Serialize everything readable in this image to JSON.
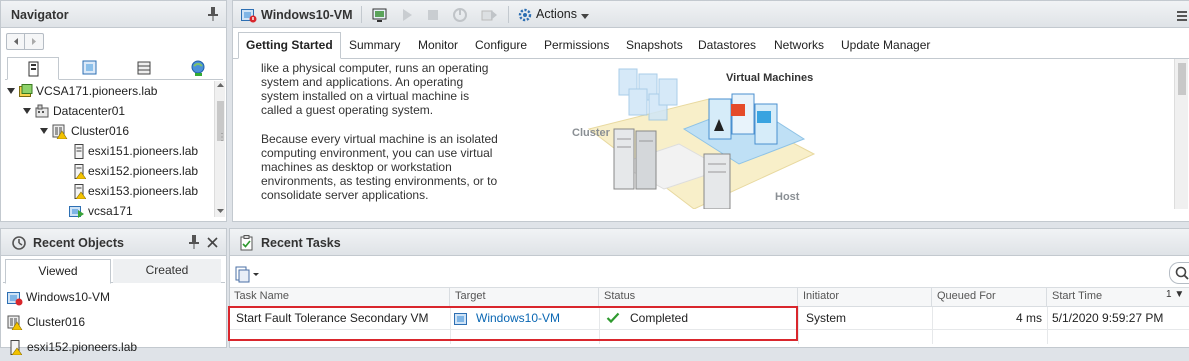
{
  "navigator": {
    "title": "Navigator",
    "tree": [
      {
        "label": "VCSA171.pioneers.lab"
      },
      {
        "label": "Datacenter01"
      },
      {
        "label": "Cluster016"
      },
      {
        "label": "esxi151.pioneers.lab"
      },
      {
        "label": "esxi152.pioneers.lab"
      },
      {
        "label": "esxi153.pioneers.lab"
      },
      {
        "label": "vcsa171"
      }
    ]
  },
  "main": {
    "title": "Windows10-VM",
    "actions_label": "Actions",
    "tabs": [
      {
        "label": "Getting Started"
      },
      {
        "label": "Summary"
      },
      {
        "label": "Monitor"
      },
      {
        "label": "Configure"
      },
      {
        "label": "Permissions"
      },
      {
        "label": "Snapshots"
      },
      {
        "label": "Datastores"
      },
      {
        "label": "Networks"
      },
      {
        "label": "Update Manager"
      }
    ],
    "getting_started": {
      "para1": [
        "like a physical computer, runs an operating",
        "system and applications. An operating",
        "system installed on a virtual machine is",
        "called a guest operating system."
      ],
      "para2": [
        "Because every virtual machine is an isolated",
        "computing environment, you can use virtual",
        "machines as desktop or workstation",
        "environments, as testing environments, or to",
        "consolidate server applications."
      ],
      "diagram": {
        "cluster": "Cluster",
        "vms": "Virtual Machines",
        "host": "Host"
      }
    }
  },
  "recent_objects": {
    "title": "Recent Objects",
    "tabs": {
      "viewed": "Viewed",
      "created": "Created"
    },
    "items": [
      {
        "label": "Windows10-VM"
      },
      {
        "label": "Cluster016"
      },
      {
        "label": "esxi152.pioneers.lab"
      }
    ]
  },
  "recent_tasks": {
    "title": "Recent Tasks",
    "columns": {
      "task_name": "Task Name",
      "target": "Target",
      "status": "Status",
      "initiator": "Initiator",
      "queued_for": "Queued For",
      "start_time": "Start Time",
      "sort_indicator": "1 ▼"
    },
    "rows": [
      {
        "task_name": "Start Fault Tolerance Secondary VM",
        "target": "Windows10-VM",
        "status": "Completed",
        "initiator": "System",
        "queued_for": "4 ms",
        "start_time": "5/1/2020 9:59:27 PM"
      }
    ]
  },
  "colors": {
    "accent": "#0a67b3",
    "highlight_border": "#d9262c",
    "status_ok": "#2f9a2f"
  }
}
